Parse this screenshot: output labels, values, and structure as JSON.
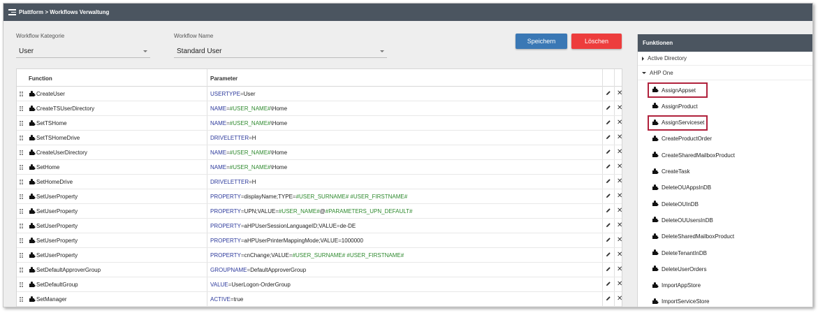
{
  "topbar": {
    "breadcrumb": "Plattform > Workflows Verwaltung"
  },
  "form": {
    "category_label": "Workflow Kategorie",
    "category_value": "User",
    "name_label": "Workflow Name",
    "name_value": "Standard User",
    "save_label": "Speichern",
    "delete_label": "Löschen"
  },
  "table": {
    "col_function": "Function",
    "col_parameter": "Parameter",
    "rows": [
      {
        "function": "CreateUser",
        "param": [
          [
            "k",
            "USERTYPE"
          ],
          [
            "eq",
            "="
          ],
          [
            "v",
            "User"
          ]
        ]
      },
      {
        "function": "CreateTSUserDirectory",
        "param": [
          [
            "k",
            "NAME"
          ],
          [
            "eq",
            "="
          ],
          [
            "var",
            "#USER_NAME#"
          ],
          [
            "v",
            "\\Home"
          ]
        ]
      },
      {
        "function": "SetTSHome",
        "param": [
          [
            "k",
            "NAME"
          ],
          [
            "eq",
            "="
          ],
          [
            "var",
            "#USER_NAME#"
          ],
          [
            "v",
            "\\Home"
          ]
        ]
      },
      {
        "function": "SetTSHomeDrive",
        "param": [
          [
            "k",
            "DRIVELETTER"
          ],
          [
            "eq",
            "="
          ],
          [
            "v",
            "H"
          ]
        ]
      },
      {
        "function": "CreateUserDirectory",
        "param": [
          [
            "k",
            "NAME"
          ],
          [
            "eq",
            "="
          ],
          [
            "var",
            "#USER_NAME#"
          ],
          [
            "v",
            "\\Home"
          ]
        ]
      },
      {
        "function": "SetHome",
        "param": [
          [
            "k",
            "NAME"
          ],
          [
            "eq",
            "="
          ],
          [
            "var",
            "#USER_NAME#"
          ],
          [
            "v",
            "\\Home"
          ]
        ]
      },
      {
        "function": "SetHomeDrive",
        "param": [
          [
            "k",
            "DRIVELETTER"
          ],
          [
            "eq",
            "="
          ],
          [
            "v",
            "H"
          ]
        ]
      },
      {
        "function": "SetUserProperty",
        "param": [
          [
            "k",
            "PROPERTY"
          ],
          [
            "eq",
            "="
          ],
          [
            "v",
            "displayName;TYPE"
          ],
          [
            "eq",
            "="
          ],
          [
            "var",
            "#USER_SURNAME# #USER_FIRSTNAME#"
          ]
        ]
      },
      {
        "function": "SetUserProperty",
        "param": [
          [
            "k",
            "PROPERTY"
          ],
          [
            "eq",
            "="
          ],
          [
            "v",
            "UPN;VALUE"
          ],
          [
            "eq",
            "="
          ],
          [
            "var",
            "#USER_NAME#"
          ],
          [
            "v",
            "@"
          ],
          [
            "var",
            "#PARAMETERS_UPN_DEFAULT#"
          ]
        ]
      },
      {
        "function": "SetUserProperty",
        "param": [
          [
            "k",
            "PROPERTY"
          ],
          [
            "eq",
            "="
          ],
          [
            "v",
            "aHPUserSessionLanguageID;VALUE"
          ],
          [
            "eq",
            "="
          ],
          [
            "v",
            "de-DE"
          ]
        ]
      },
      {
        "function": "SetUserProperty",
        "param": [
          [
            "k",
            "PROPERTY"
          ],
          [
            "eq",
            "="
          ],
          [
            "v",
            "aHPUserPrinterMappingMode;VALUE"
          ],
          [
            "eq",
            "="
          ],
          [
            "v",
            "1000000"
          ]
        ]
      },
      {
        "function": "SetUserProperty",
        "param": [
          [
            "k",
            "PROPERTY"
          ],
          [
            "eq",
            "="
          ],
          [
            "v",
            "cnChange;VALUE"
          ],
          [
            "eq",
            "="
          ],
          [
            "var",
            "#USER_SURNAME# #USER_FIRSTNAME#"
          ]
        ]
      },
      {
        "function": "SetDefaultApproverGroup",
        "param": [
          [
            "k",
            "GROUPNAME"
          ],
          [
            "eq",
            "="
          ],
          [
            "v",
            "DefaultApproverGroup"
          ]
        ]
      },
      {
        "function": "SetDefaultGroup",
        "param": [
          [
            "k",
            "VALUE"
          ],
          [
            "eq",
            "="
          ],
          [
            "v",
            "UserLogon-OrderGroup"
          ]
        ]
      },
      {
        "function": "SetManager",
        "param": [
          [
            "k",
            "ACTIVE"
          ],
          [
            "eq",
            "="
          ],
          [
            "v",
            "true"
          ]
        ]
      }
    ]
  },
  "sidebar": {
    "title": "Funktionen",
    "groups": [
      {
        "label": "Active Directory",
        "expanded": false
      },
      {
        "label": "AHP One",
        "expanded": true
      }
    ],
    "functions": [
      {
        "label": "AssignAppset",
        "highlight": true
      },
      {
        "label": "AssignProduct",
        "highlight": false
      },
      {
        "label": "AssignServiceset",
        "highlight": true
      },
      {
        "label": "CreateProductOrder",
        "highlight": false
      },
      {
        "label": "CreateSharedMailboxProduct",
        "highlight": false
      },
      {
        "label": "CreateTask",
        "highlight": false
      },
      {
        "label": "DeleteOUAppsInDB",
        "highlight": false
      },
      {
        "label": "DeleteOUInDB",
        "highlight": false
      },
      {
        "label": "DeleteOUUsersInDB",
        "highlight": false
      },
      {
        "label": "DeleteSharedMailboxProduct",
        "highlight": false
      },
      {
        "label": "DeleteTenantInDB",
        "highlight": false
      },
      {
        "label": "DeleteUserOrders",
        "highlight": false
      },
      {
        "label": "ImportAppStore",
        "highlight": false
      },
      {
        "label": "ImportServiceStore",
        "highlight": false
      }
    ]
  },
  "colors": {
    "topbar": "#4b5560",
    "save": "#3a78b5",
    "delete": "#ed3d3d",
    "highlight_border": "#b0213c",
    "param_key": "#2d3a9c",
    "param_variable": "#2f8a2f"
  },
  "icons": {
    "menu": "menu-icon",
    "function": "puzzle-icon",
    "edit": "pencil-icon",
    "remove": "close-icon",
    "drag": "drag-handle-icon"
  }
}
